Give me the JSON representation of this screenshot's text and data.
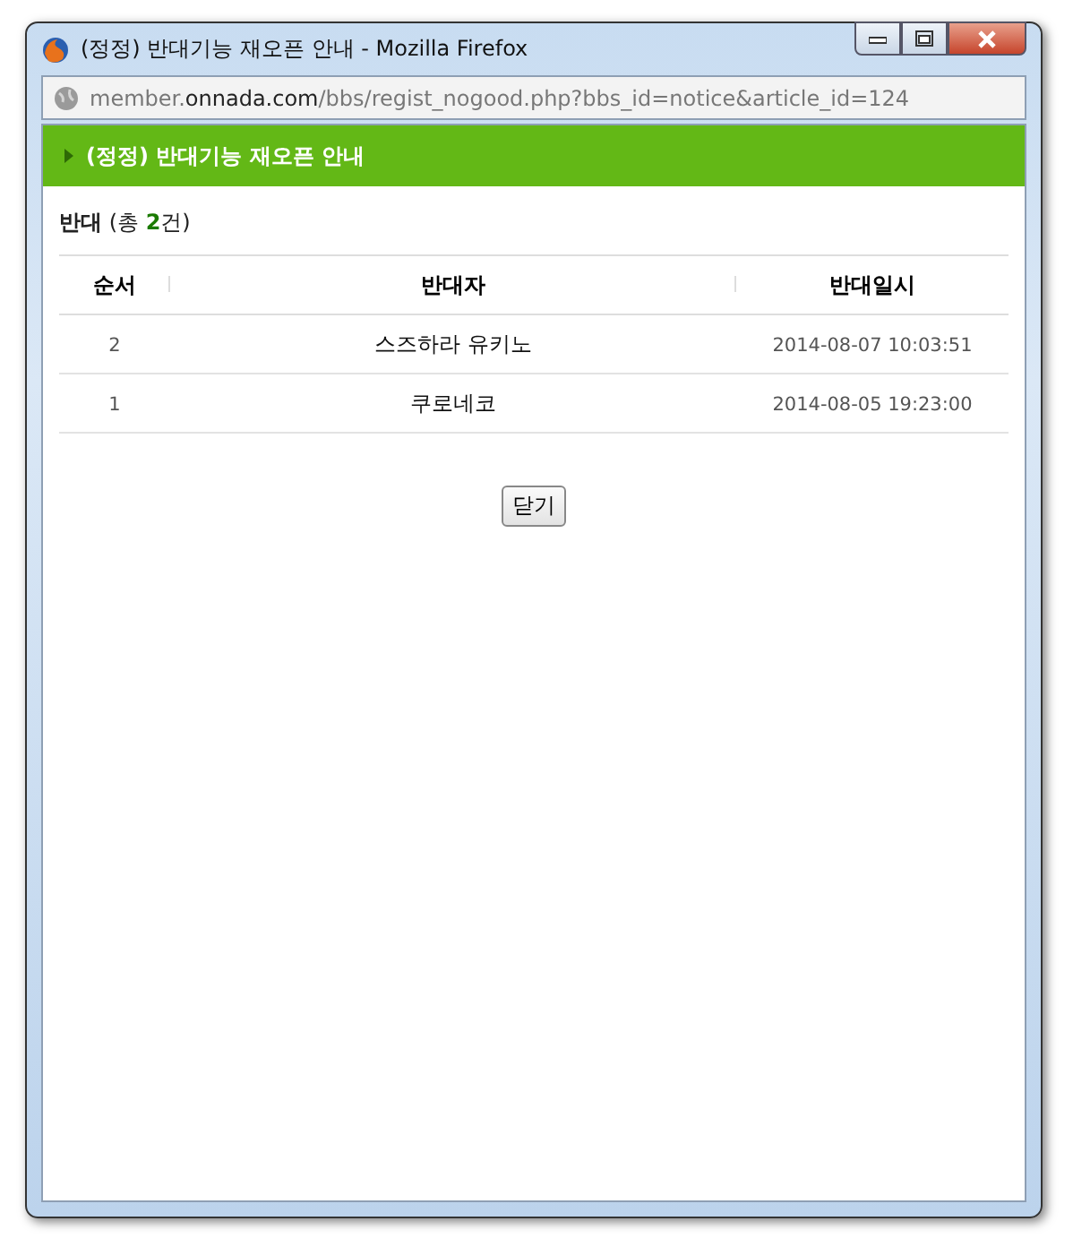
{
  "window": {
    "title": "(정정) 반대기능 재오픈 안내 - Mozilla Firefox"
  },
  "address_bar": {
    "parts": [
      {
        "text": "member.",
        "kind": "dim"
      },
      {
        "text": "onnada.com",
        "kind": "domain"
      },
      {
        "text": "/bbs/regist_nogood.php?bbs_id=notice&article_id=124",
        "kind": "dim"
      }
    ]
  },
  "header": {
    "title": "(정정) 반대기능 재오픈 안내"
  },
  "summary": "**반대** (총 **2**건)",
  "table": {
    "columns": [
      "순서",
      "반대자",
      "반대일시"
    ],
    "rows": [
      [
        "2",
        "스즈하라 유키노",
        "2014-08-07 10:03:51"
      ],
      [
        "1",
        "쿠로네코",
        "2014-08-05 19:23:00"
      ]
    ]
  },
  "close_button": "닫기"
}
